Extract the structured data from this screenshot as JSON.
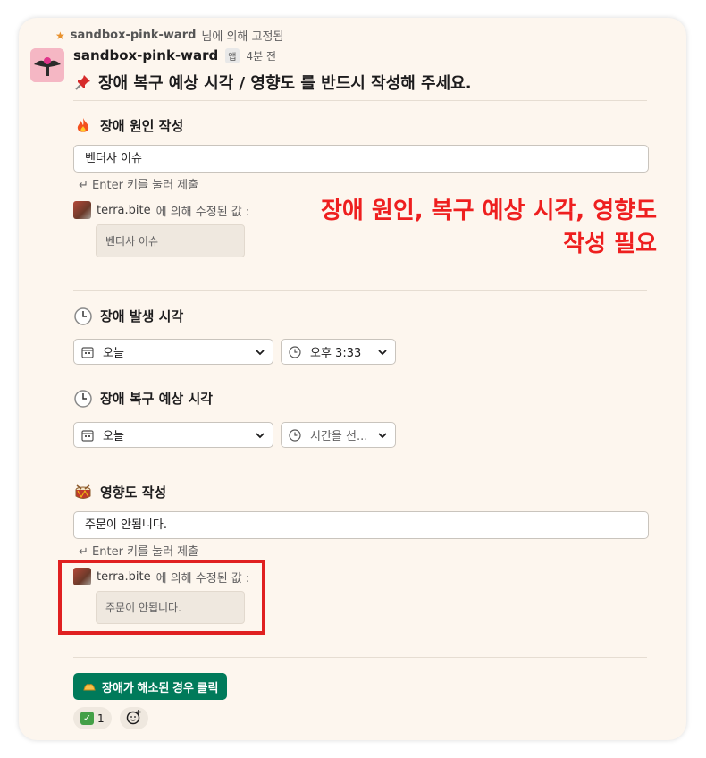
{
  "pinned": {
    "user": "sandbox-pink-ward",
    "text": "님에 의해 고정됨"
  },
  "message": {
    "sender": "sandbox-pink-ward",
    "app_badge": "앱",
    "time": "4분 전",
    "title_icon": "pushpin-icon",
    "title": "장애 복구 예상 시각 / 영향도 를 반드시 작성해 주세요."
  },
  "cause": {
    "icon": "fire-icon",
    "title": "장애 원인 작성",
    "value": "벤더사 이슈",
    "hint": "↵ Enter 키를 눌러 제출",
    "edited_by": "terra.bite",
    "edited_text": "에 의해 수정된 값 :",
    "edited_value": "벤더사  이슈"
  },
  "occurred": {
    "icon": "clock-icon",
    "title": "장애 발생 시각",
    "date": "오늘",
    "time": "오후 3:33"
  },
  "recovery": {
    "icon": "clock-icon",
    "title": "장애 복구 예상 시각",
    "date": "오늘",
    "time_placeholder": "시간을 선..."
  },
  "impact": {
    "icon": "drum-icon",
    "title": "영향도 작성",
    "value": "주문이 안됩니다.",
    "hint": "↵ Enter 키를 눌러 제출",
    "edited_by": "terra.bite",
    "edited_text": "에 의해 수정된 값 :",
    "edited_value": "주문이  안됩니다."
  },
  "annotation": {
    "line1": "장애 원인, 복구 예상 시각, 영향도",
    "line2": "작성 필요",
    "color": "#ee1f1f"
  },
  "actions": {
    "resolve_icon": "praying-hands-icon",
    "resolve_label": "장애가 해소된 경우 클릭",
    "reaction_count": "1",
    "accent": "#007a5a"
  }
}
